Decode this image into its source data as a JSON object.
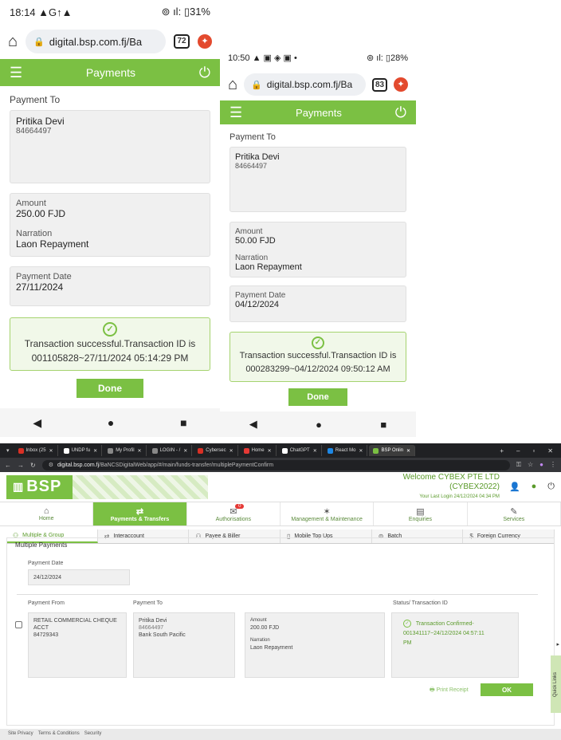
{
  "phone1": {
    "status": {
      "time": "18:14",
      "left_icons": "▲G↑▲",
      "right_icons": "⊚ ıl:",
      "battery": "31%"
    },
    "url": "digital.bsp.com.fj/Ba",
    "tabs_count": "72",
    "app_title": "Payments",
    "payment_to_label": "Payment To",
    "payee_name": "Pritika Devi",
    "payee_account": "84664497",
    "amount_label": "Amount",
    "amount_value": "250.00 FJD",
    "narration_label": "Narration",
    "narration_value": "Laon Repayment",
    "date_label": "Payment Date",
    "date_value": "27/11/2024",
    "success_line1": "Transaction successful.Transaction ID is",
    "success_line2": "001105828~27/11/2024 05:14:29 PM",
    "done_label": "Done"
  },
  "phone2": {
    "status": {
      "time": "10:50",
      "left_icons": "▲ ▣ ◈ ▣ •",
      "right_icons": "⊚ ıl:",
      "battery": "28%"
    },
    "url": "digital.bsp.com.fj/Ba",
    "tabs_count": "83",
    "app_title": "Payments",
    "payment_to_label": "Payment To",
    "payee_name": "Pritika Devi",
    "payee_account": "84664497",
    "amount_label": "Amount",
    "amount_value": "50.00 FJD",
    "narration_label": "Narration",
    "narration_value": "Laon Repayment",
    "date_label": "Payment Date",
    "date_value": "04/12/2024",
    "success_line1": "Transaction successful.Transaction ID is",
    "success_line2": "000283299~04/12/2024 09:50:12 AM",
    "done_label": "Done"
  },
  "desktop": {
    "browser_tabs": [
      {
        "label": "Inbox (25",
        "color": "#d93025"
      },
      {
        "label": "UNDP fu",
        "color": "#ffffff"
      },
      {
        "label": "My Profil",
        "color": "#888888"
      },
      {
        "label": "LOGIN - /",
        "color": "#888888"
      },
      {
        "label": "Cybersec",
        "color": "#d93025"
      },
      {
        "label": "Home",
        "color": "#e53935"
      },
      {
        "label": "ChatGPT",
        "color": "#ffffff"
      },
      {
        "label": "React Mo",
        "color": "#1e88e5"
      },
      {
        "label": "BSP Onlin",
        "color": "#7bc043"
      }
    ],
    "address_host": "digital.bsp.com.fj",
    "address_path": "/BaNCSDigitalWeb/app/#/main/funds-transfer/multiplePaymentConfirm",
    "logo_text": "BSP",
    "welcome_line1": "Welcome CYBEX PTE LTD",
    "welcome_line2": "(CYBEX2022)",
    "last_login": "Your Last Login 24/12/2024 04:34 PM",
    "nav": [
      {
        "label": "Home",
        "icon": "⌂"
      },
      {
        "label": "Payments & Transfers",
        "icon": "⇄"
      },
      {
        "label": "Authorisations",
        "icon": "✉"
      },
      {
        "label": "Management & Maintenance",
        "icon": "✶"
      },
      {
        "label": "Enquiries",
        "icon": "▤"
      },
      {
        "label": "Services",
        "icon": "✎"
      }
    ],
    "auth_badge": "0",
    "sub_tabs": [
      {
        "label": "Multiple & Group",
        "icon": "⚇"
      },
      {
        "label": "Interaccount",
        "icon": "⇄"
      },
      {
        "label": "Payee & Biller",
        "icon": "⚇"
      },
      {
        "label": "Mobile Top Ups",
        "icon": "▯"
      },
      {
        "label": "Batch",
        "icon": "⊜"
      },
      {
        "label": "Foreign Currency",
        "icon": "$"
      }
    ],
    "panel_title": "Multiple Payments",
    "payment_date_label": "Payment Date",
    "payment_date_value": "24/12/2024",
    "payment_from_label": "Payment From",
    "payment_to_label": "Payment To",
    "status_label": "Status/ Transaction ID",
    "from_account_name": "RETAIL COMMERCIAL CHEQUE ACCT",
    "from_account_no": "84729343",
    "to_name": "Pritika Devi",
    "to_account": "84664497",
    "to_bank": "Bank South Pacific",
    "amount_label": "Amount",
    "amount_value": "200.00 FJD",
    "narration_label": "Narration",
    "narration_value": "Laon Repayment",
    "confirm_line1": "Transaction Confirmed-",
    "confirm_line2": "001341117~24/12/2024 04:57:11",
    "confirm_line3": "PM",
    "print_receipt": "Print Receipt",
    "ok_label": "OK",
    "quick_links": "Quick Links",
    "footer": [
      "Site Privacy",
      "Terms & Conditions",
      "Security"
    ]
  }
}
